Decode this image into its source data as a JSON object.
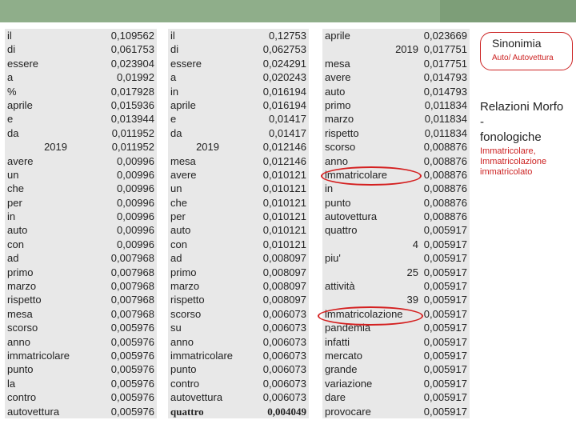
{
  "col1": [
    {
      "word": "il",
      "value": "0,109562"
    },
    {
      "word": "di",
      "value": "0,061753"
    },
    {
      "word": "essere",
      "value": "0,023904"
    },
    {
      "word": "a",
      "value": "0,01992"
    },
    {
      "word": "%",
      "value": "0,017928"
    },
    {
      "word": "aprile",
      "value": "0,015936"
    },
    {
      "word": "e",
      "value": "0,013944"
    },
    {
      "word": "da",
      "value": "0,011952"
    },
    {
      "word": "2019",
      "value": "0,011952",
      "numeric": true
    },
    {
      "word": "avere",
      "value": "0,00996"
    },
    {
      "word": "un",
      "value": "0,00996"
    },
    {
      "word": "che",
      "value": "0,00996"
    },
    {
      "word": "per",
      "value": "0,00996"
    },
    {
      "word": "in",
      "value": "0,00996"
    },
    {
      "word": "auto",
      "value": "0,00996"
    },
    {
      "word": "con",
      "value": "0,00996"
    },
    {
      "word": "ad",
      "value": "0,007968"
    },
    {
      "word": "primo",
      "value": "0,007968"
    },
    {
      "word": "marzo",
      "value": "0,007968"
    },
    {
      "word": "rispetto",
      "value": "0,007968"
    },
    {
      "word": "mesa",
      "value": "0,007968"
    },
    {
      "word": "scorso",
      "value": "0,005976"
    },
    {
      "word": "anno",
      "value": "0,005976"
    },
    {
      "word": "immatricolare",
      "value": "0,005976"
    },
    {
      "word": "punto",
      "value": "0,005976"
    },
    {
      "word": "la",
      "value": "0,005976"
    },
    {
      "word": "contro",
      "value": "0,005976"
    },
    {
      "word": "autovettura",
      "value": "0,005976"
    }
  ],
  "col2": [
    {
      "word": "il",
      "value": "0,12753"
    },
    {
      "word": "di",
      "value": "0,062753"
    },
    {
      "word": "essere",
      "value": "0,024291"
    },
    {
      "word": "a",
      "value": "0,020243"
    },
    {
      "word": "in",
      "value": "0,016194"
    },
    {
      "word": "aprile",
      "value": "0,016194"
    },
    {
      "word": "e",
      "value": "0,01417"
    },
    {
      "word": "da",
      "value": "0,01417"
    },
    {
      "word": "2019",
      "value": "0,012146",
      "numeric": true
    },
    {
      "word": "mesa",
      "value": "0,012146"
    },
    {
      "word": "avere",
      "value": "0,010121"
    },
    {
      "word": "un",
      "value": "0,010121"
    },
    {
      "word": "che",
      "value": "0,010121"
    },
    {
      "word": "per",
      "value": "0,010121"
    },
    {
      "word": "auto",
      "value": "0,010121"
    },
    {
      "word": "con",
      "value": "0,010121"
    },
    {
      "word": "ad",
      "value": "0,008097"
    },
    {
      "word": "primo",
      "value": "0,008097"
    },
    {
      "word": "marzo",
      "value": "0,008097"
    },
    {
      "word": "rispetto",
      "value": "0,008097"
    },
    {
      "word": "scorso",
      "value": "0,006073"
    },
    {
      "word": "su",
      "value": "0,006073"
    },
    {
      "word": "anno",
      "value": "0,006073"
    },
    {
      "word": "immatricolare",
      "value": "0,006073"
    },
    {
      "word": "punto",
      "value": "0,006073"
    },
    {
      "word": "contro",
      "value": "0,006073"
    },
    {
      "word": "autovettura",
      "value": "0,006073"
    },
    {
      "word": "quattro",
      "value": "0,004049",
      "bold": true
    }
  ],
  "col3": [
    {
      "word": "aprile",
      "num": "",
      "value": "0,023669"
    },
    {
      "word": "",
      "num": "2019",
      "value": "0,017751"
    },
    {
      "word": "mesa",
      "num": "",
      "value": "0,017751"
    },
    {
      "word": "avere",
      "num": "",
      "value": "0,014793"
    },
    {
      "word": "auto",
      "num": "",
      "value": "0,014793"
    },
    {
      "word": "primo",
      "num": "",
      "value": "0,011834"
    },
    {
      "word": "marzo",
      "num": "",
      "value": "0,011834"
    },
    {
      "word": "rispetto",
      "num": "",
      "value": "0,011834"
    },
    {
      "word": "scorso",
      "num": "",
      "value": "0,008876"
    },
    {
      "word": "anno",
      "num": "",
      "value": "0,008876"
    },
    {
      "word": "immatricolare",
      "num": "",
      "value": "0,008876"
    },
    {
      "word": "in",
      "num": "",
      "value": "0,008876"
    },
    {
      "word": "punto",
      "num": "",
      "value": "0,008876"
    },
    {
      "word": "autovettura",
      "num": "",
      "value": "0,008876"
    },
    {
      "word": "quattro",
      "num": "",
      "value": "0,005917"
    },
    {
      "word": "",
      "num": "4",
      "value": "0,005917"
    },
    {
      "word": "piu'",
      "num": "",
      "value": "0,005917"
    },
    {
      "word": "",
      "num": "25",
      "value": "0,005917"
    },
    {
      "word": "attività",
      "num": "",
      "value": "0,005917"
    },
    {
      "word": "",
      "num": "39",
      "value": "0,005917"
    },
    {
      "word": "immatricolazione",
      "num": "",
      "value": "0,005917"
    },
    {
      "word": "pandemia",
      "num": "",
      "value": "0,005917"
    },
    {
      "word": "infatti",
      "num": "",
      "value": "0,005917"
    },
    {
      "word": "mercato",
      "num": "",
      "value": "0,005917"
    },
    {
      "word": "grande",
      "num": "",
      "value": "0,005917"
    },
    {
      "word": "variazione",
      "num": "",
      "value": "0,005917"
    },
    {
      "word": "dare",
      "num": "",
      "value": "0,005917"
    },
    {
      "word": "provocare",
      "num": "",
      "value": "0,005917"
    }
  ],
  "annotations": {
    "sinonimia_title": "Sinonimia",
    "sinonimia_sub": "Auto/ Autovettura",
    "relazioni_line1": "Relazioni Morfo",
    "relazioni_line2": "-",
    "relazioni_line3": "fonologiche",
    "relazioni_items": [
      "Immatricolare,",
      "Immatricolazione",
      "immatricolato"
    ]
  },
  "colors": {
    "header_bar": "#8fae8a",
    "table_bg": "#e8e8e8",
    "accent_red": "#cc2222"
  }
}
